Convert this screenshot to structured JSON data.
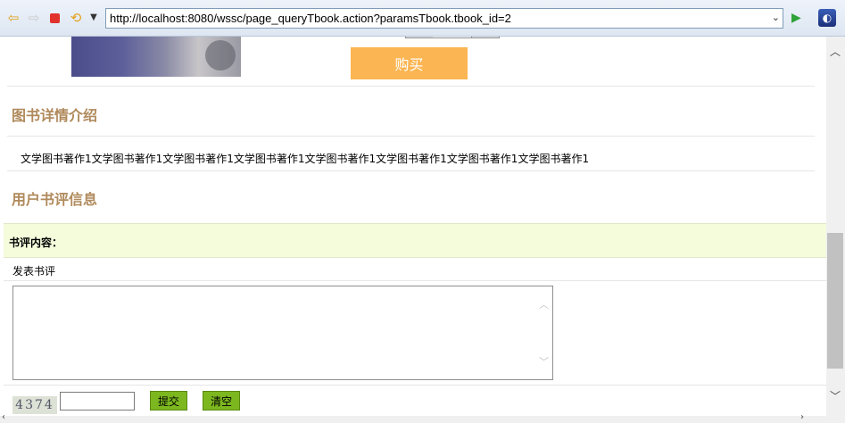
{
  "browser": {
    "url": "http://localhost:8080/wssc/page_queryTbook.action?paramsTbook.tbook_id=2",
    "icons": [
      "back-arrow-icon",
      "forward-arrow-icon",
      "stop-icon",
      "refresh-icon",
      "dropdown-icon",
      "go-icon",
      "extension-icon"
    ]
  },
  "product": {
    "buy_label": "购买"
  },
  "detail": {
    "title": "图书详情介绍",
    "description": "文学图书著作1文学图书著作1文学图书著作1文学图书著作1文学图书著作1文学图书著作1文学图书著作1文学图书著作1"
  },
  "reviews": {
    "title": "用户书评信息",
    "content_label": "书评内容：",
    "post_label": "发表书评",
    "captcha": "4374",
    "submit_label": "提交",
    "clear_label": "清空"
  },
  "colors": {
    "accent_title": "#b08a5c",
    "buy_button": "#fbb552",
    "green_button": "#7cb71f",
    "review_bar": "#f4fcdc"
  }
}
